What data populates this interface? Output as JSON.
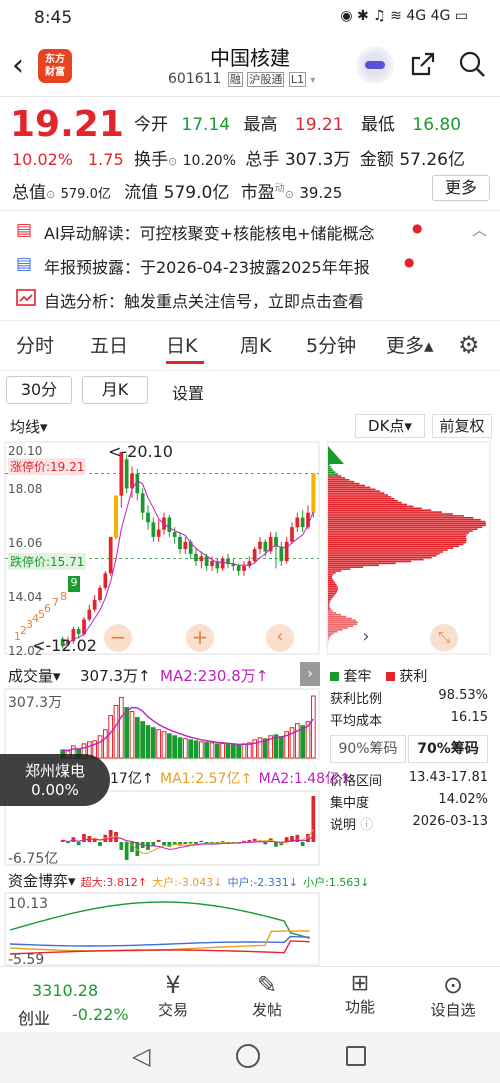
{
  "status": {
    "time": "8:45",
    "right": "◉ ✱ ♫ ≋ 4G 4G ▭"
  },
  "header": {
    "title": "中国核建",
    "code": "601611",
    "badges": [
      "融",
      "沪股通",
      "L1"
    ]
  },
  "quote": {
    "price": "19.21",
    "pct": "10.02%",
    "chg": "1.75",
    "open_label": "今开",
    "open": "17.14",
    "high_label": "最高",
    "high": "19.21",
    "low_label": "最低",
    "low": "16.80",
    "turnover_label": "换手",
    "turnover": "10.20%",
    "vol_label": "总手",
    "vol": "307.3万",
    "amount_label": "金额",
    "amount": "57.26亿",
    "mktcap_label": "总值",
    "mktcap": "579.0亿",
    "float_label": "流值",
    "float": "579.0亿",
    "pe_label": "市盈",
    "pe_sup": "动",
    "pe": "39.25",
    "more": "更多"
  },
  "alerts": [
    {
      "text": "AI异动解读：可控核聚变+核能核电+储能概念",
      "dot": true
    },
    {
      "text": "年报预披露：于2026-04-23披露2025年年报",
      "dot": true
    },
    {
      "text": "自选分析：触发重点关注信号，立即点击查看",
      "dot": false
    }
  ],
  "tabs": [
    "分时",
    "五日",
    "日K",
    "周K",
    "5分钟",
    "更多▴"
  ],
  "active_tab": "日K",
  "subtabs": [
    "30分",
    "月K",
    "设置"
  ],
  "chart": {
    "ma_label": "均线▾",
    "dk_label": "DK点▾",
    "adj_label": "前复权",
    "y_top": "20.10",
    "y_18": "18.08",
    "y_16": "16.06",
    "y_14": "14.04",
    "y_bot": "12.02",
    "peak_label": "<-20.10",
    "low_label": "<-12.02",
    "limit_up": "涨停价:19.21",
    "limit_down": "跌停价:15.71",
    "markers": [
      "9",
      "8",
      "7",
      "6",
      "5",
      "4",
      "3",
      "2",
      "1"
    ]
  },
  "chip_legend": {
    "trap": "套牢",
    "profit": "获利"
  },
  "chip_stats": [
    {
      "label": "获利比例",
      "value": "98.53%"
    },
    {
      "label": "平均成本",
      "value": "16.15"
    }
  ],
  "chip_tabs": [
    "90%筹码",
    "70%筹码"
  ],
  "chip_stats2": [
    {
      "label": "价格区间",
      "value": "13.43-17.81"
    },
    {
      "label": "集中度",
      "value": "14.02%"
    },
    {
      "label": "说明",
      "value": "2026-03-13"
    }
  ],
  "volume": {
    "label": "成交量▾",
    "val": "307.3万↑",
    "ma2": "MA2:230.8万↑",
    "ymax": "307.3万"
  },
  "fund": {
    "line": "17亿↑",
    "ma1": "MA1:2.57亿↑",
    "ma2": "MA2:1.48亿↑",
    "ymin": "-6.75亿"
  },
  "popup": {
    "name": "郑州煤电",
    "value": "0.00%"
  },
  "game": {
    "label": "资金博弈▾",
    "super": "超大:3.812↑",
    "big": "大户:-3.043↓",
    "mid": "中户:-2.331↓",
    "small": "小户:1.563↓",
    "ytop": "10.13",
    "ybot": "-5.59"
  },
  "bottom_nav": {
    "index_val": "3310.28",
    "index_name": "创业",
    "index_pct": "-0.22%",
    "items": [
      "交易",
      "发帖",
      "功能",
      "设自选"
    ]
  },
  "colors": {
    "up": "#e2252c",
    "down": "#1a9a2e"
  },
  "candles": [
    [
      12.4,
      12.1,
      12.5,
      12.0
    ],
    [
      12.2,
      12.3,
      12.5,
      12.1
    ],
    [
      12.3,
      12.8,
      12.9,
      12.2
    ],
    [
      12.8,
      12.6,
      12.9,
      12.4
    ],
    [
      12.6,
      13.2,
      13.3,
      12.5
    ],
    [
      13.2,
      13.6,
      13.8,
      13.1
    ],
    [
      13.6,
      14.0,
      14.2,
      13.5
    ],
    [
      14.0,
      14.5,
      14.6,
      13.9
    ],
    [
      14.5,
      15.1,
      15.2,
      14.4
    ],
    [
      15.1,
      16.6,
      16.6,
      15.0
    ],
    [
      16.6,
      18.3,
      18.3,
      16.5
    ],
    [
      18.3,
      20.1,
      20.1,
      17.8
    ],
    [
      19.8,
      18.6,
      20.0,
      18.4
    ],
    [
      18.6,
      19.2,
      19.5,
      18.2
    ],
    [
      19.2,
      18.4,
      19.4,
      18.1
    ],
    [
      18.4,
      17.6,
      18.6,
      17.3
    ],
    [
      17.6,
      17.2,
      17.9,
      16.9
    ],
    [
      17.2,
      16.6,
      17.4,
      16.4
    ],
    [
      16.6,
      16.9,
      17.3,
      16.4
    ],
    [
      16.9,
      17.4,
      17.6,
      16.7
    ],
    [
      17.4,
      16.8,
      17.5,
      16.6
    ],
    [
      16.8,
      16.6,
      17.0,
      16.3
    ],
    [
      16.6,
      16.1,
      16.8,
      15.9
    ],
    [
      16.1,
      16.4,
      16.6,
      15.9
    ],
    [
      16.4,
      15.9,
      16.5,
      15.7
    ],
    [
      15.9,
      15.6,
      16.1,
      15.4
    ],
    [
      15.6,
      15.8,
      16.0,
      15.3
    ],
    [
      15.8,
      15.4,
      15.9,
      15.2
    ],
    [
      15.4,
      15.6,
      15.8,
      15.2
    ],
    [
      15.6,
      15.3,
      15.7,
      15.1
    ],
    [
      15.3,
      15.7,
      15.8,
      15.2
    ],
    [
      15.7,
      15.5,
      15.9,
      15.3
    ],
    [
      15.5,
      15.4,
      15.7,
      15.2
    ],
    [
      15.4,
      15.2,
      15.5,
      15.0
    ],
    [
      15.2,
      15.4,
      15.6,
      15.0
    ],
    [
      15.4,
      15.6,
      15.8,
      15.3
    ],
    [
      15.6,
      16.1,
      16.2,
      15.5
    ],
    [
      16.1,
      16.4,
      16.6,
      15.9
    ],
    [
      16.4,
      16.0,
      16.5,
      15.8
    ],
    [
      16.0,
      16.6,
      16.8,
      15.9
    ],
    [
      16.6,
      16.2,
      16.8,
      15.3
    ],
    [
      16.2,
      15.6,
      16.4,
      15.4
    ],
    [
      15.6,
      16.4,
      16.6,
      15.5
    ],
    [
      16.4,
      17.0,
      17.2,
      16.3
    ],
    [
      17.0,
      17.4,
      17.6,
      16.8
    ],
    [
      17.4,
      17.0,
      17.7,
      16.8
    ],
    [
      17.0,
      17.6,
      17.9,
      16.9
    ],
    [
      17.6,
      19.21,
      19.21,
      17.4
    ]
  ],
  "volumes": [
    40,
    35,
    60,
    45,
    70,
    80,
    85,
    110,
    140,
    210,
    260,
    300,
    250,
    230,
    200,
    180,
    160,
    150,
    140,
    130,
    120,
    110,
    100,
    95,
    90,
    85,
    80,
    78,
    75,
    70,
    72,
    68,
    66,
    64,
    70,
    75,
    90,
    100,
    95,
    110,
    115,
    105,
    130,
    150,
    170,
    160,
    180,
    307
  ],
  "fund_bars": [
    0.5,
    -0.3,
    1.2,
    -0.8,
    2.0,
    1.5,
    0.8,
    -1.0,
    1.8,
    3.0,
    2.5,
    -2.0,
    -4.5,
    -2.5,
    -3.5,
    -1.5,
    -2.0,
    -1.0,
    0.5,
    -0.8,
    -1.2,
    -0.6,
    -0.9,
    -0.5,
    -0.4,
    -0.6,
    0.3,
    -0.5,
    -0.3,
    -0.4,
    0.2,
    -0.3,
    -0.2,
    -0.4,
    0.3,
    0.5,
    0.8,
    0.4,
    -0.6,
    0.9,
    -1.2,
    -0.8,
    1.2,
    1.5,
    1.8,
    -1.0,
    2.0,
    11.5
  ]
}
